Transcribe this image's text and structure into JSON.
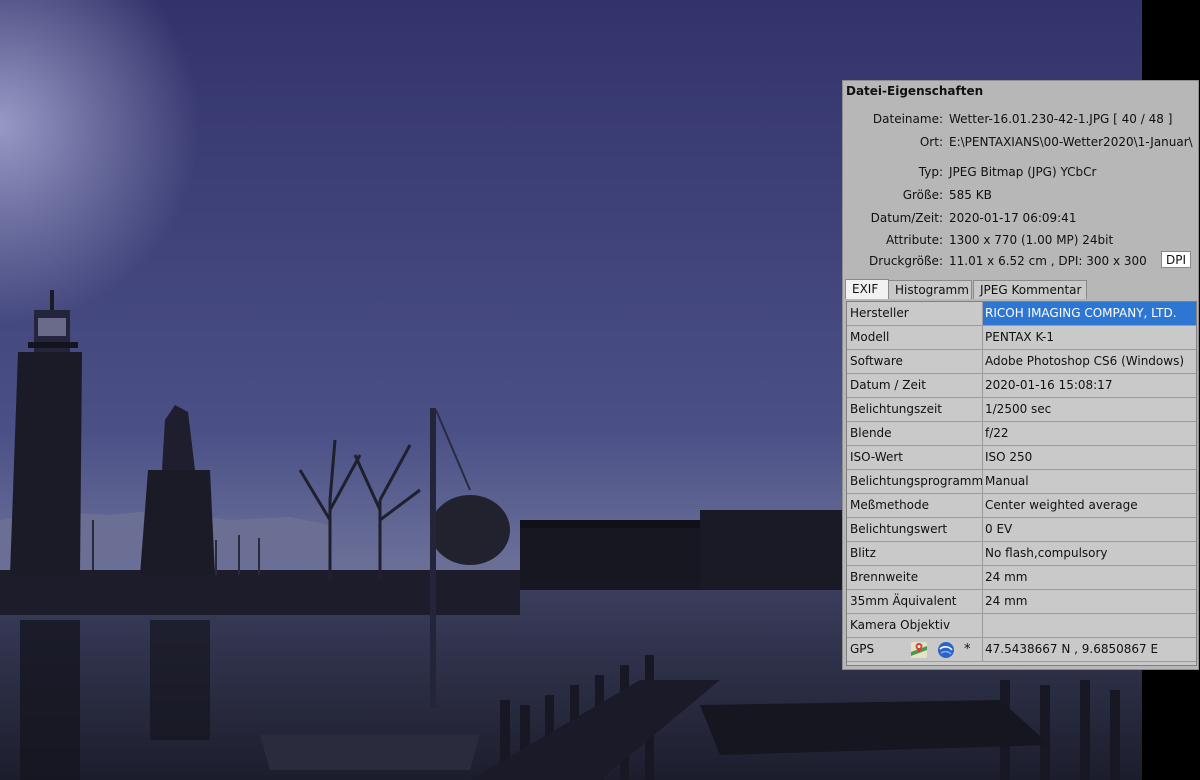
{
  "panel": {
    "title": "Datei-Eigenschaften",
    "info": [
      {
        "label": "Dateiname:",
        "value": "Wetter-16.01.230-42-1.JPG   [ 40 / 48 ]"
      },
      {
        "label": "Ort:",
        "value": "E:\\PENTAXIANS\\00-Wetter2020\\1-Januar\\"
      },
      {
        "label": "Typ:",
        "value": "JPEG Bitmap (JPG) YCbCr"
      },
      {
        "label": "Größe:",
        "value": "585 KB"
      },
      {
        "label": "Datum/Zeit:",
        "value": "2020-01-17 06:09:41"
      },
      {
        "label": "Attribute:",
        "value": "1300 x 770 (1.00 MP)  24bit"
      },
      {
        "label": "Druckgröße:",
        "value": "11.01 x 6.52 cm ,  DPI: 300 x 300"
      }
    ],
    "dpi_button": "DPI",
    "tabs": [
      "EXIF",
      "Histogramm",
      "JPEG Kommentar"
    ],
    "active_tab": "EXIF",
    "exif_rows": [
      {
        "key": "Hersteller",
        "value": "RICOH IMAGING COMPANY, LTD.",
        "selected": true
      },
      {
        "key": "Modell",
        "value": "PENTAX K-1"
      },
      {
        "key": "Software",
        "value": "Adobe Photoshop CS6 (Windows)"
      },
      {
        "key": "Datum / Zeit",
        "value": "2020-01-16 15:08:17"
      },
      {
        "key": "Belichtungszeit",
        "value": "1/2500 sec"
      },
      {
        "key": "Blende",
        "value": "f/22"
      },
      {
        "key": "ISO-Wert",
        "value": "ISO 250"
      },
      {
        "key": "Belichtungsprogramm",
        "value": "Manual"
      },
      {
        "key": "Meßmethode",
        "value": "Center weighted average"
      },
      {
        "key": "Belichtungswert",
        "value": "0 EV"
      },
      {
        "key": "Blitz",
        "value": "No flash,compulsory"
      },
      {
        "key": "Brennweite",
        "value": "24 mm"
      },
      {
        "key": "35mm Äquivalent",
        "value": "24 mm"
      },
      {
        "key": "Kamera Objektiv",
        "value": ""
      },
      {
        "key": "GPS",
        "value": "47.5438667 N  ,  9.6850867 E"
      }
    ],
    "gps_star": "*",
    "gps_icons": [
      "google-maps-icon",
      "google-earth-icon"
    ]
  },
  "colors": {
    "panel_bg": "#b7b7b7",
    "selection": "#2d77d3",
    "sky_top": "#35356e",
    "sky_bottom": "#5a6290"
  }
}
